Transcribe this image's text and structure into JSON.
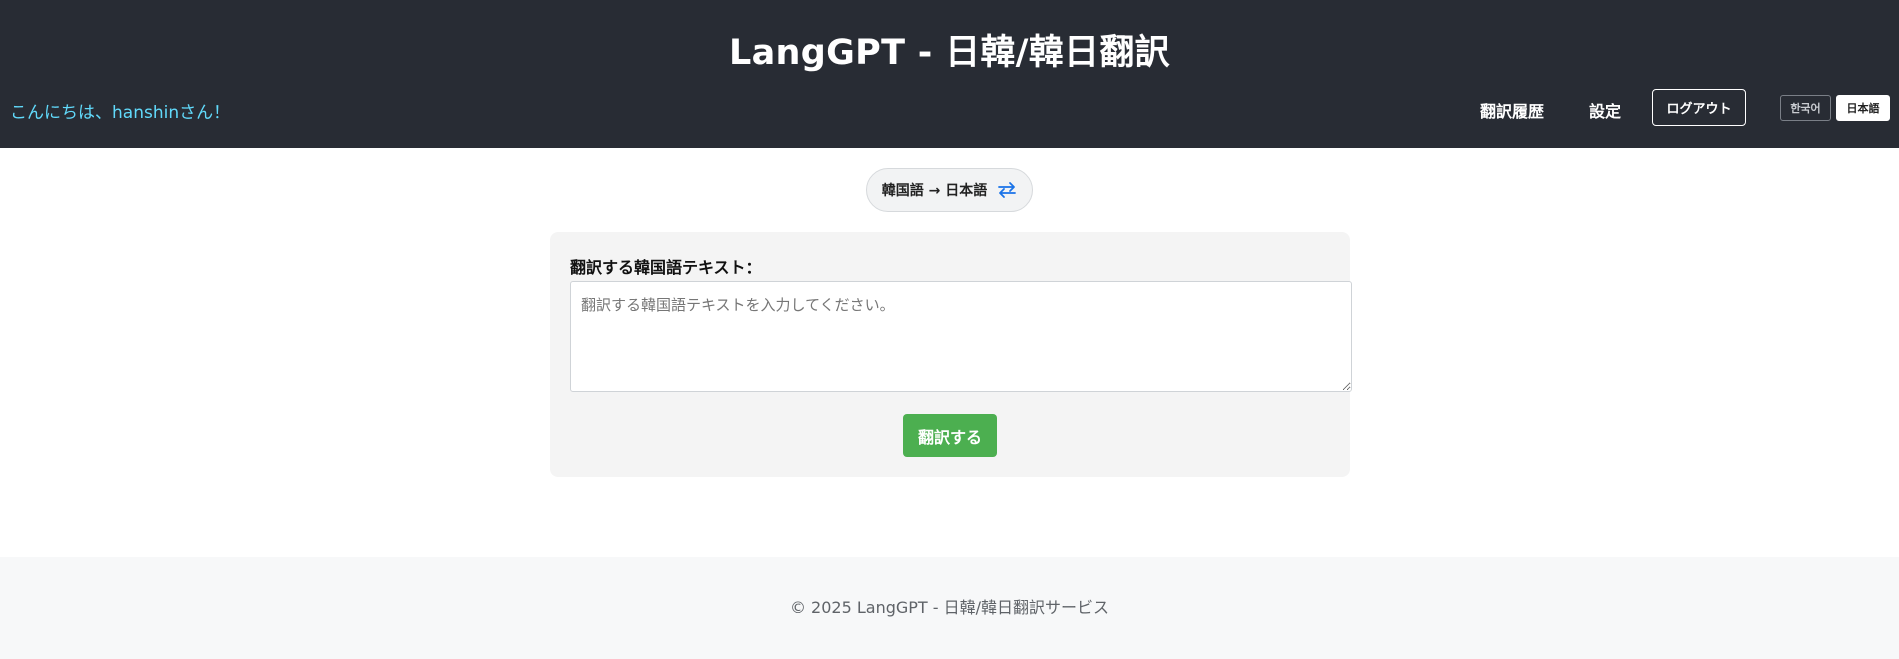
{
  "app": {
    "title": "LangGPT - 日韓/韓日翻訳"
  },
  "header": {
    "greeting": "こんにちは、hanshinさん！",
    "nav": {
      "history_label": "翻訳履歴",
      "settings_label": "設定",
      "logout_label": "ログアウト"
    },
    "language_switch": {
      "options": [
        "한국어",
        "日本語"
      ],
      "selected": "日本語"
    }
  },
  "direction": {
    "label": "韓国語 → 日本語",
    "icon": "swap-icon",
    "icon_color": "#1a73e8"
  },
  "form": {
    "input_label": "翻訳する韓国語テキスト：",
    "input_value": "",
    "input_placeholder": "翻訳する韓国語テキストを入力してください。",
    "submit_label": "翻訳する"
  },
  "footer": {
    "text": "© 2025 LangGPT - 日韓/韓日翻訳サービス"
  },
  "colors": {
    "header_bg": "#282c34",
    "greeting": "#61dafb",
    "submit_bg": "#4caf50",
    "card_bg": "#f4f4f4",
    "footer_bg": "#f7f8f9"
  }
}
